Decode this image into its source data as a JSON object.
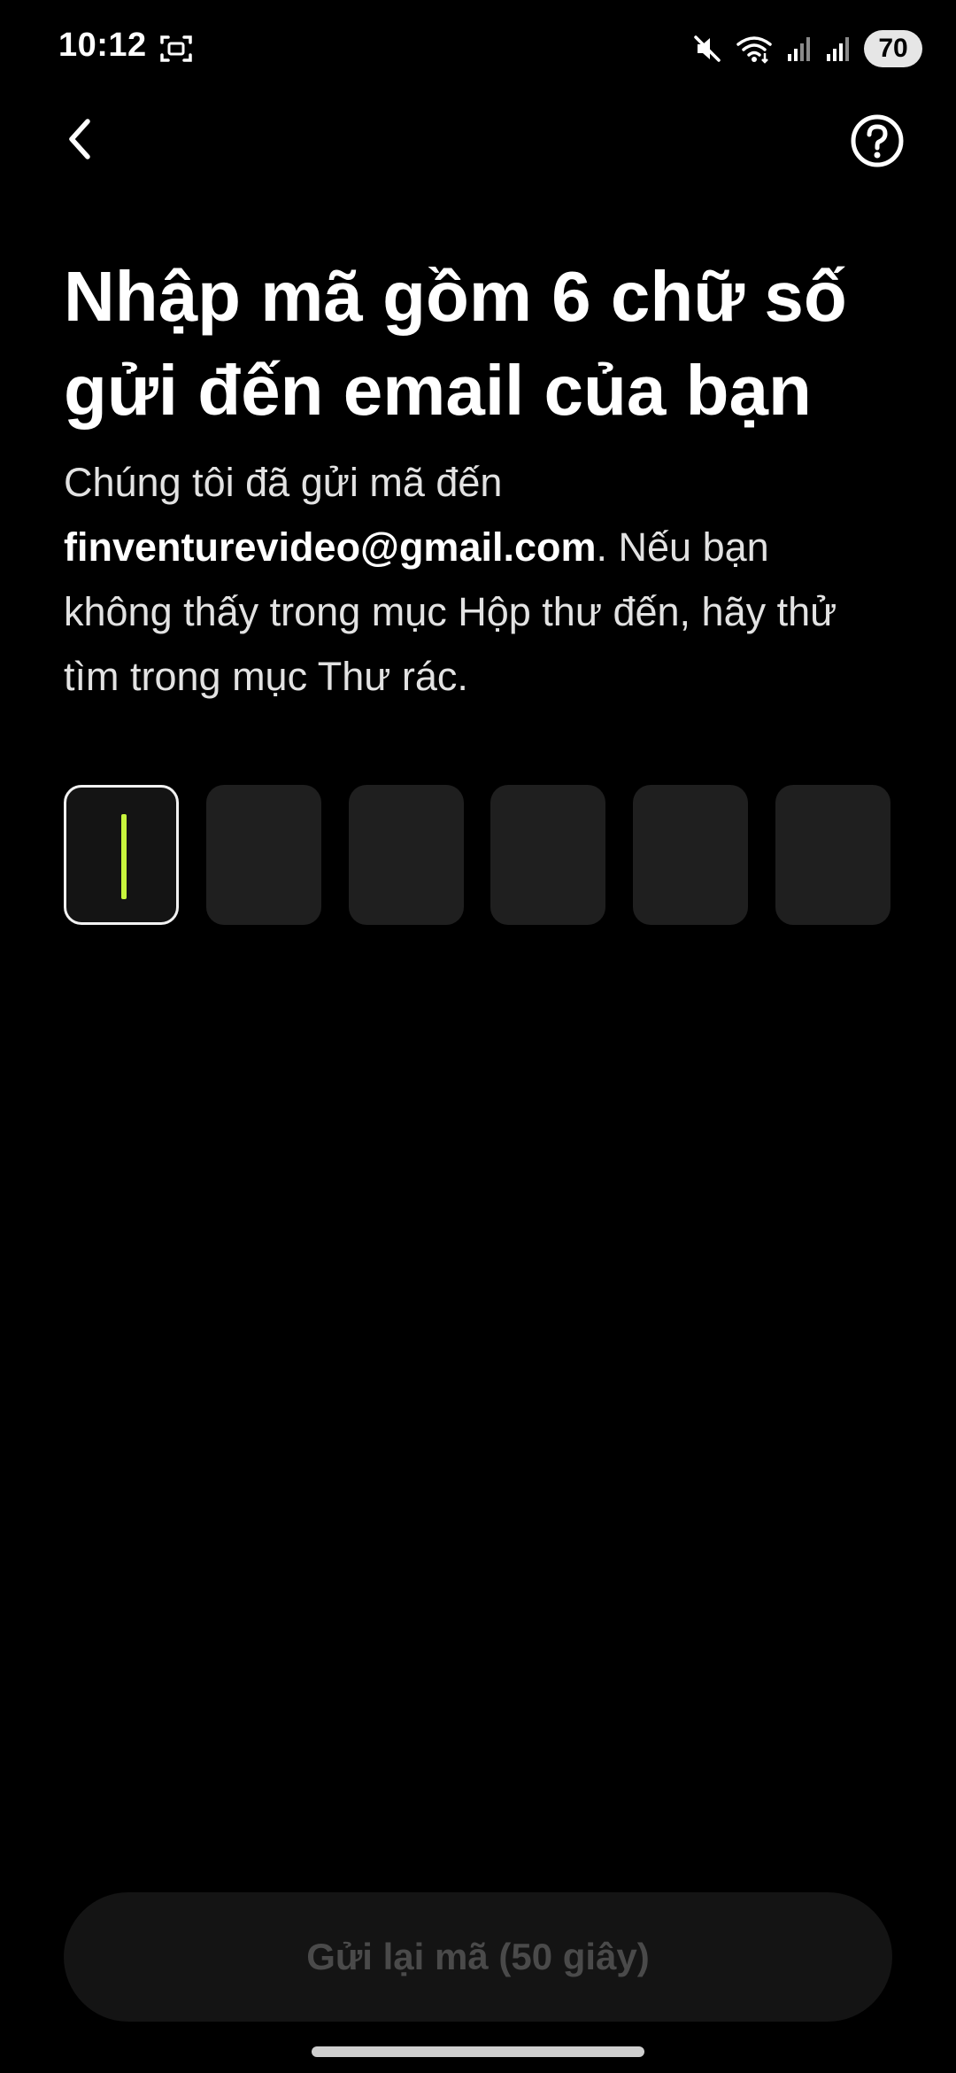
{
  "status_bar": {
    "time": "10:12",
    "battery": "70"
  },
  "title": "Nhập mã gồm 6 chữ số gửi đến email của bạn",
  "description": {
    "prefix": "Chúng tôi đã gửi mã đến ",
    "email": "finventurevideo@gmail.com",
    "suffix": ". Nếu bạn không thấy trong mục Hộp thư đến, hãy thử tìm trong mục Thư rác."
  },
  "code": {
    "length": 6,
    "digits": [
      "",
      "",
      "",
      "",
      "",
      ""
    ],
    "active_index": 0,
    "caret_color": "#c8f53d"
  },
  "resend_label": "Gửi lại mã (50 giây)",
  "icons": {
    "back": "chevron-left-icon",
    "help": "question-circle-icon",
    "screenshot": "screen-capture-icon",
    "mute": "mute-icon",
    "wifi": "wifi-icon",
    "signal": "signal-icon"
  },
  "colors": {
    "background": "#000000",
    "accent": "#c8f53d",
    "box": "#1f1f1f"
  }
}
